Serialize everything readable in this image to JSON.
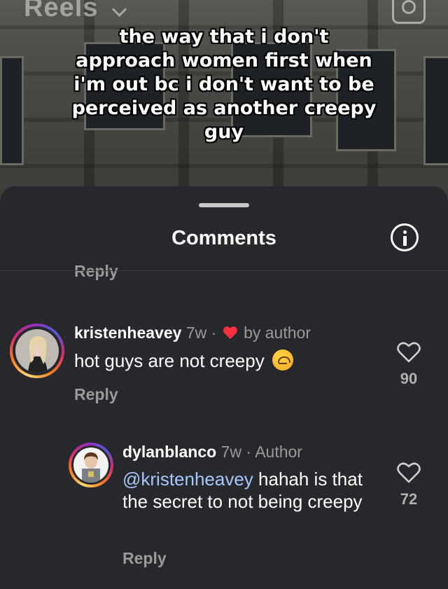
{
  "header": {
    "title": "Reels",
    "camera_icon": "camera-icon"
  },
  "video": {
    "caption": "the way that i don't approach women first when i'm out bc i don't want to be perceived as another creepy guy"
  },
  "sheet": {
    "title": "Comments",
    "info_icon": "info-icon",
    "cut_reply": "Reply"
  },
  "comments": [
    {
      "username": "kristenheavey",
      "time": "7w",
      "separator": "·",
      "liked_by_author": "by author",
      "text": "hot guys are not creepy",
      "emoji": "upside-down-face",
      "reply": "Reply",
      "likes": "90"
    },
    {
      "username": "dylanblanco",
      "time": "7w",
      "separator": "·",
      "role": "Author",
      "mention": "@kristenheavey",
      "text": " hahah is that the secret to not being creepy",
      "reply": "Reply",
      "likes": "72"
    }
  ],
  "colors": {
    "sheet_bg": "#26282c",
    "mention": "#a9c7ff",
    "heart_red": "#ff3040",
    "muted": "#9a9a9a"
  }
}
